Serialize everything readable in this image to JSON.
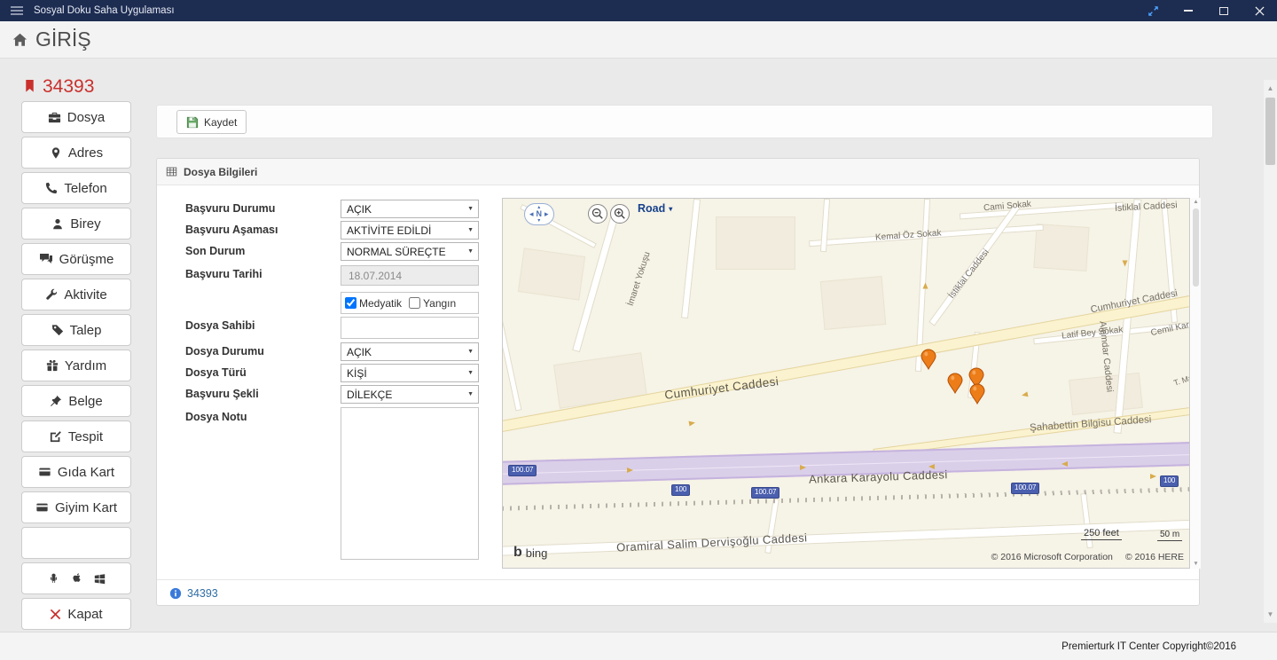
{
  "titlebar": {
    "title": "Sosyal Doku Saha Uygulaması"
  },
  "header": {
    "title": "GİRİŞ"
  },
  "record": {
    "id": "34393"
  },
  "sidebar": {
    "items": [
      {
        "label": "Dosya"
      },
      {
        "label": "Adres"
      },
      {
        "label": "Telefon"
      },
      {
        "label": "Birey"
      },
      {
        "label": "Görüşme"
      },
      {
        "label": "Aktivite"
      },
      {
        "label": "Talep"
      },
      {
        "label": "Yardım"
      },
      {
        "label": "Belge"
      },
      {
        "label": "Tespit"
      },
      {
        "label": "Gıda Kart"
      },
      {
        "label": "Giyim Kart"
      }
    ],
    "kapat_label": "Kapat"
  },
  "toolbar": {
    "save_label": "Kaydet"
  },
  "panel": {
    "title": "Dosya Bilgileri",
    "footer_link": "34393"
  },
  "form": {
    "basvuru_durumu": {
      "label": "Başvuru Durumu",
      "value": "AÇIK"
    },
    "basvuru_asamasi": {
      "label": "Başvuru Aşaması",
      "value": "AKTİVİTE EDİLDİ"
    },
    "son_durum": {
      "label": "Son Durum",
      "value": "NORMAL SÜREÇTE"
    },
    "basvuru_tarihi": {
      "label": "Başvuru Tarihi",
      "value": "18.07.2014"
    },
    "medyatik": {
      "label": "Medyatik",
      "checked": true
    },
    "yangin": {
      "label": "Yangın",
      "checked": false
    },
    "dosya_sahibi": {
      "label": "Dosya Sahibi",
      "value": ""
    },
    "dosya_durumu": {
      "label": "Dosya Durumu",
      "value": "AÇIK"
    },
    "dosya_turu": {
      "label": "Dosya Türü",
      "value": "KİŞİ"
    },
    "basvuru_sekli": {
      "label": "Başvuru Şekli",
      "value": "DİLEKÇE"
    },
    "dosya_notu": {
      "label": "Dosya Notu",
      "value": ""
    }
  },
  "map": {
    "style_label": "Road",
    "compass_label": "N",
    "logo": "bing",
    "scale_imperial": "250 feet",
    "scale_metric": "50 m",
    "copyright_microsoft": "© 2016 Microsoft Corporation",
    "copyright_here": "© 2016 HERE",
    "shields": [
      "100.07",
      "100",
      "100.07",
      "100.07",
      "100"
    ],
    "streets": [
      "Cami Sokak",
      "Kemal Öz Sokak",
      "İstiklal Caddesi",
      "İstiklal Caddesi",
      "Cumhuriyet Caddesi",
      "Cumhuriyet Caddesi",
      "Cemil Karakadılar",
      "Latif Bey Sokak",
      "Alemdar Caddesi",
      "İmaret Yokuşu",
      "Şahabettin Bilgisu Caddesi",
      "Ankara Karayolu Caddesi",
      "Oramiral Salim Dervişoğlu Caddesi",
      "T. Marm"
    ]
  },
  "footer": {
    "copyright": "Premierturk IT Center Copyright©2016"
  }
}
